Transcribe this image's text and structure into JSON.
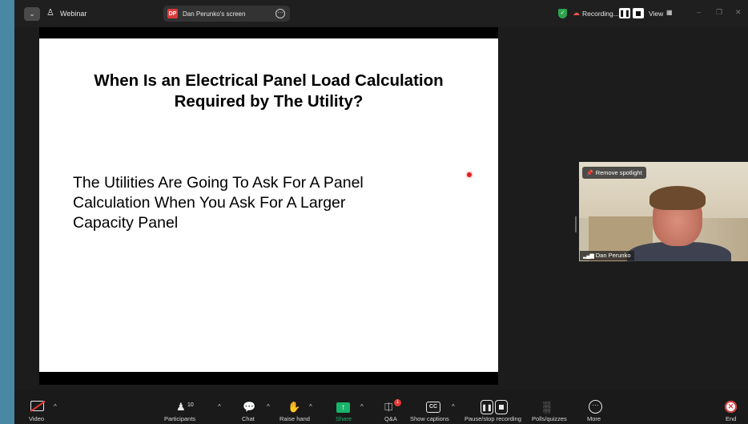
{
  "titlebar": {
    "dropdown_glyph": "⌄",
    "webinar_title": "Webinar",
    "screen_owner_initials": "DP",
    "screen_label": "Dan Perunko's screen",
    "more_glyph": "⋯",
    "recording_label": "Recording...",
    "pause_glyph": "❚❚",
    "view_label": "View",
    "window_controls": [
      "–",
      "❐",
      "✕"
    ]
  },
  "slide": {
    "title_line1": "When Is an Electrical Panel Load Calculation",
    "title_line2": "Required by The Utility?",
    "body_line1": "The Utilities Are Going To Ask For A Panel",
    "body_line2": "Calculation When You Ask For A Larger",
    "body_line3": "Capacity Panel"
  },
  "video_tile": {
    "spotlight_label": "Remove spotlight",
    "participant_name": "Dan Perunko"
  },
  "toolbar": {
    "video_label": "Video",
    "participants_label": "Participants",
    "participants_count": "10",
    "chat_label": "Chat",
    "raise_hand_label": "Raise hand",
    "share_label": "Share",
    "qa_label": "Q&A",
    "qa_badge": "1",
    "captions_label": "Show captions",
    "cc_text": "CC",
    "pause_recording_label": "Pause/stop recording",
    "polls_label": "Polls/quizzes",
    "more_label": "More",
    "end_label": "End",
    "caret": "^"
  },
  "colors": {
    "share_green": "#19b36b",
    "record_red": "#ff4d4d",
    "end_red": "#d93b3b",
    "shield_green": "#2ea44f"
  },
  "icons": [
    "dropdown-icon",
    "webinar-icon",
    "more-icon",
    "shield-icon",
    "cloud-record-icon",
    "pause-icon",
    "stop-icon",
    "view-icon",
    "pin-icon",
    "signal-icon",
    "video-off-icon",
    "participants-icon",
    "chat-icon",
    "raise-hand-icon",
    "share-icon",
    "qa-icon",
    "captions-icon",
    "polls-icon",
    "end-icon"
  ]
}
